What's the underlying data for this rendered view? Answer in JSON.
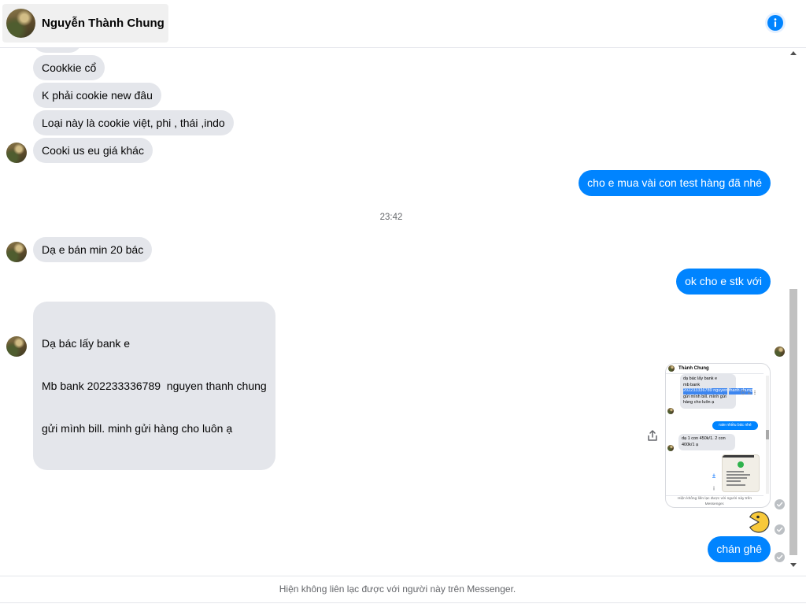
{
  "header": {
    "contact_name": "Nguyễn Thành Chung",
    "avatar_icon": "contact-avatar-icon",
    "info_icon": "info-icon"
  },
  "thread": [
    {
      "outgoing": false,
      "text": "Cookkie cổ"
    },
    {
      "outgoing": false,
      "text": "K phải cookie new đâu"
    },
    {
      "outgoing": false,
      "text": "Loại này là cookie việt, phi , thái ,indo"
    },
    {
      "outgoing": false,
      "text": "Cooki us eu giá khác"
    },
    {
      "outgoing": true,
      "text": "cho e mua vài con test hàng đã nhé"
    },
    {
      "outgoing": false,
      "text": "Dạ e bán min 20 bác"
    },
    {
      "outgoing": true,
      "text": "ok cho e stk với"
    },
    {
      "outgoing": false,
      "lines": [
        "Dạ bác lấy bank e",
        "Mb bank 202233336789  nguyen thanh chung",
        "gửi mình bill. minh gửi hàng cho luôn ạ"
      ]
    },
    {
      "outgoing": true,
      "image": {
        "header_name": "Thành Chung",
        "bubble_lines": [
          "dạ bác lấy bank e",
          "mb bank",
          "202233336789 nguyen",
          "thanh chung",
          "gửi mình bill. mình gửi",
          "hàng cho luôn ạ"
        ],
        "highlighted_lines": [
          2,
          3
        ],
        "outgoing_text": "rate nhiều bác nhé",
        "reply_lines": [
          "dạ 1 con 450k/1. 2 con",
          "400k/1 ạ"
        ],
        "notice_lines": [
          "Hiện không liên lạc được với người này trên",
          "Messenger."
        ]
      }
    },
    {
      "outgoing": true,
      "sticker_icon": "pacman-sticker-icon"
    },
    {
      "outgoing": true,
      "text": "chán ghê"
    }
  ],
  "timestamp_divider": "23:42",
  "footer": {
    "notice": "Hiện không liên lạc được với người này trên Messenger."
  },
  "icons": {
    "share": "share-icon",
    "seen": "seen-check-icon",
    "read_receipt": "read-receipt-avatar-icon"
  },
  "colors": {
    "outgoing_bubble": "#0084ff",
    "incoming_bubble": "#e4e6eb",
    "muted_text": "#65676b",
    "accent": "#0084ff"
  }
}
